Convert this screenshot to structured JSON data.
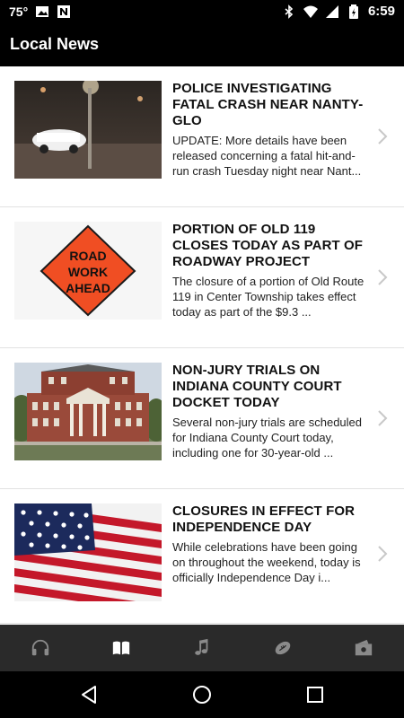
{
  "status_bar": {
    "temperature": "75°",
    "time": "6:59",
    "left_icons": [
      "image-icon",
      "news-app-icon"
    ],
    "right_icons": [
      "bluetooth-icon",
      "wifi-icon",
      "signal-icon",
      "battery-charging-icon"
    ]
  },
  "app_bar": {
    "title": "Local News"
  },
  "articles": [
    {
      "headline": "POLICE INVESTIGATING FATAL CRASH NEAR NANTY-GLO",
      "summary": "UPDATE: More details have been released concerning a fatal hit-and-run crash Tuesday night near Nant...",
      "thumbnail": "night-street-car-photo"
    },
    {
      "headline": "PORTION OF OLD 119 CLOSES TODAY AS PART OF ROADWAY PROJECT",
      "summary": "The closure of a portion of Old Route 119 in Center Township takes effect today as part of the $9.3 ...",
      "thumbnail": "road-work-ahead-sign",
      "sign_text": [
        "ROAD",
        "WORK",
        "AHEAD"
      ]
    },
    {
      "headline": "NON-JURY TRIALS ON INDIANA COUNTY COURT DOCKET TODAY",
      "summary": "Several non-jury trials are scheduled for Indiana County Court today, including one for 30-year-old ...",
      "thumbnail": "courthouse-photo"
    },
    {
      "headline": "CLOSURES IN EFFECT FOR INDEPENDENCE DAY",
      "summary": "While celebrations have been going on throughout the weekend, today is officially Independence Day i...",
      "thumbnail": "american-flag-photo"
    }
  ],
  "tab_bar": {
    "tabs": [
      {
        "icon": "headphones-icon",
        "active": false
      },
      {
        "icon": "book-open-icon",
        "active": true
      },
      {
        "icon": "music-note-icon",
        "active": false
      },
      {
        "icon": "football-icon",
        "active": false
      },
      {
        "icon": "ticket-icon",
        "active": false
      }
    ]
  },
  "nav_bar": {
    "buttons": [
      "back-icon",
      "home-icon",
      "recents-icon"
    ]
  },
  "colors": {
    "app_bar": "#000000",
    "tab_bar": "#2a2a2a",
    "tab_active": "#ffffff",
    "tab_inactive": "#8a8a8a",
    "chevron": "#c8c8c8",
    "sign_orange": "#f04e23"
  }
}
